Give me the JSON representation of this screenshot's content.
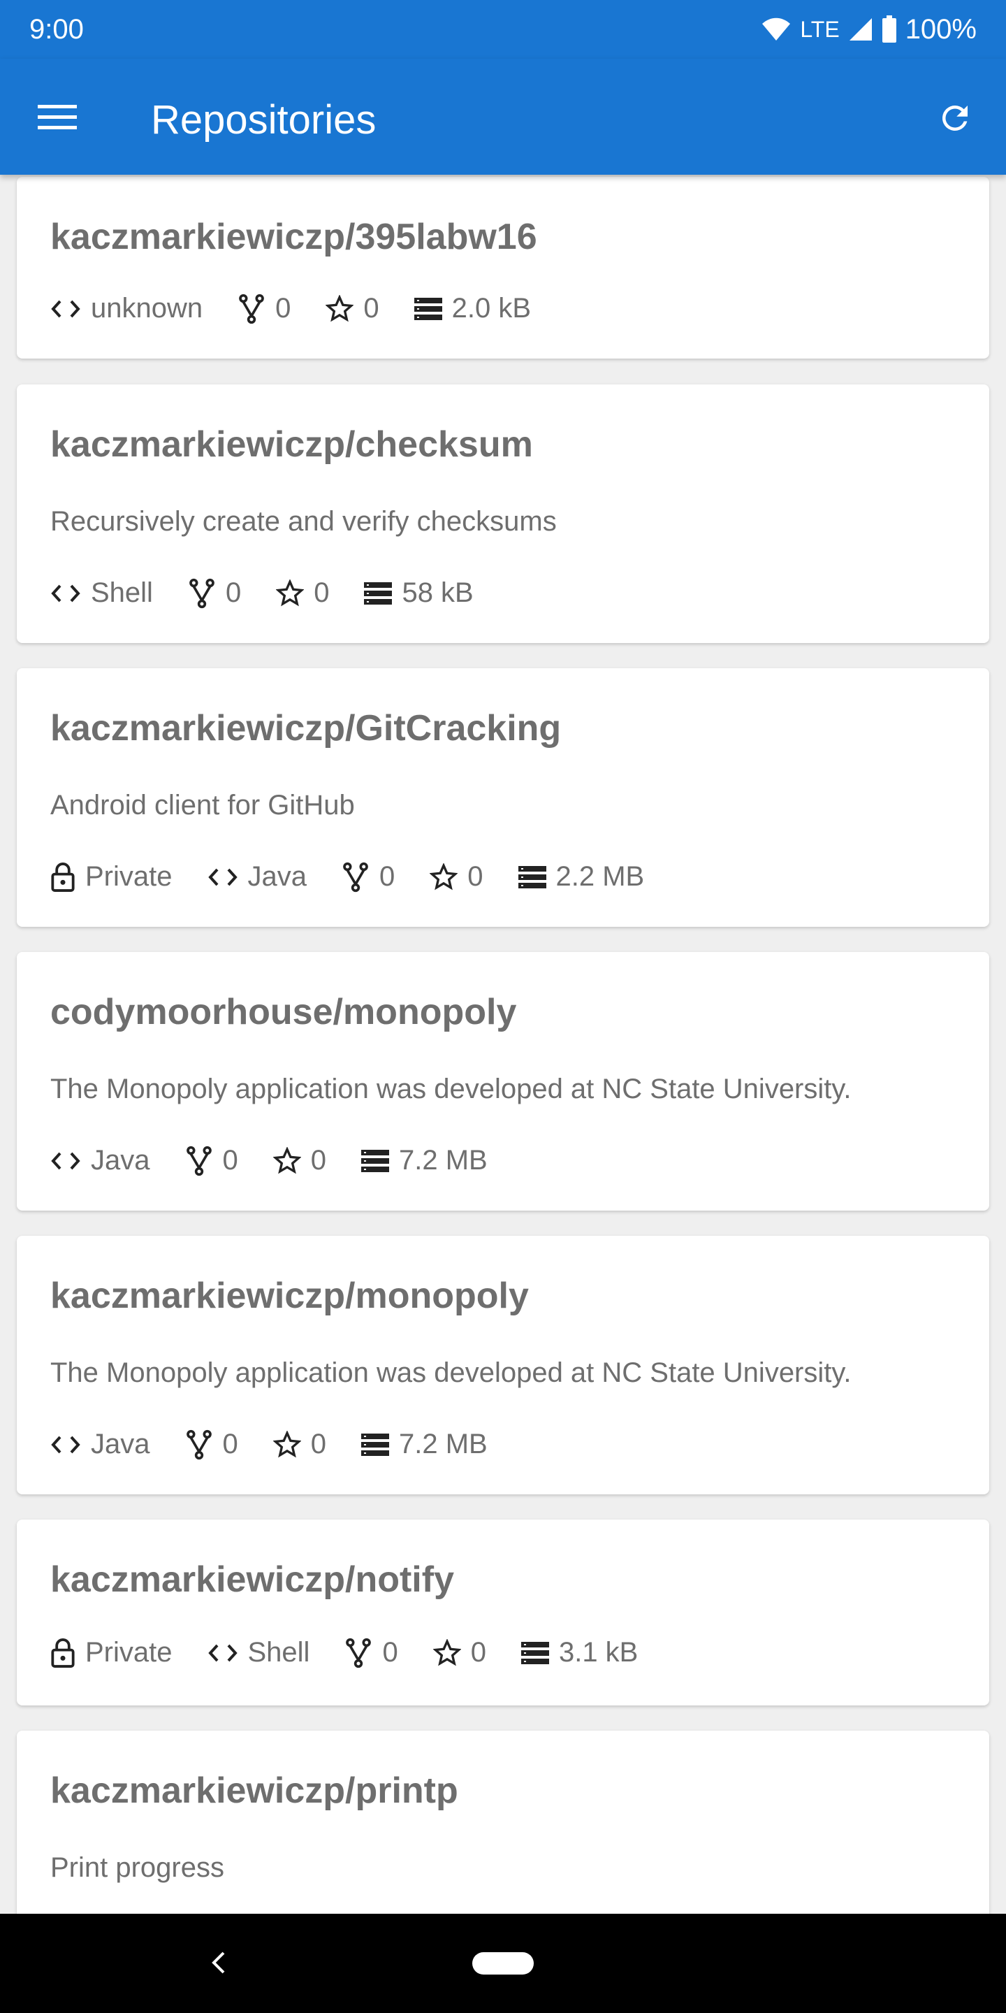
{
  "status": {
    "time": "9:00",
    "network": "LTE",
    "battery": "100%"
  },
  "app_bar": {
    "title": "Repositories"
  },
  "repos": [
    {
      "name": "kaczmarkiewiczp/395labw16",
      "description": "",
      "private": "",
      "language": "unknown",
      "forks": "0",
      "stars": "0",
      "size": "2.0 kB"
    },
    {
      "name": "kaczmarkiewiczp/checksum",
      "description": "Recursively create and verify checksums",
      "private": "",
      "language": "Shell",
      "forks": "0",
      "stars": "0",
      "size": "58 kB"
    },
    {
      "name": "kaczmarkiewiczp/GitCracking",
      "description": "Android client for GitHub",
      "private": "Private",
      "language": "Java",
      "forks": "0",
      "stars": "0",
      "size": "2.2 MB"
    },
    {
      "name": "codymoorhouse/monopoly",
      "description": "The Monopoly application was developed at NC State University.",
      "private": "",
      "language": "Java",
      "forks": "0",
      "stars": "0",
      "size": "7.2 MB"
    },
    {
      "name": "kaczmarkiewiczp/monopoly",
      "description": "The Monopoly application was developed at NC State University.",
      "private": "",
      "language": "Java",
      "forks": "0",
      "stars": "0",
      "size": "7.2 MB"
    },
    {
      "name": "kaczmarkiewiczp/notify",
      "description": "",
      "private": "Private",
      "language": "Shell",
      "forks": "0",
      "stars": "0",
      "size": "3.1 kB"
    },
    {
      "name": "kaczmarkiewiczp/printp",
      "description": "Print progress",
      "private": "",
      "language": "",
      "forks": "",
      "stars": "",
      "size": ""
    }
  ],
  "icons": {
    "menu": "menu-icon",
    "refresh": "refresh-icon",
    "lock": "lock-icon",
    "code": "code-icon",
    "fork": "fork-icon",
    "star": "star-icon",
    "storage": "storage-icon"
  },
  "colors": {
    "primary": "#1976d2",
    "card": "#ffffff",
    "background": "#efefef",
    "text": "#6e6e6e"
  }
}
